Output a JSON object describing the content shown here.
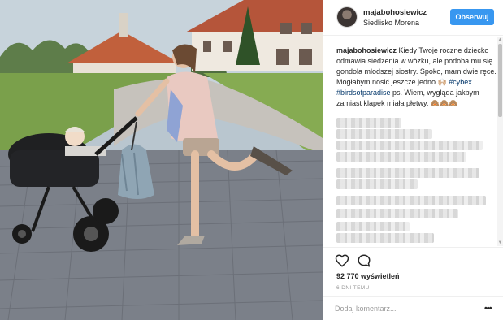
{
  "post": {
    "username": "majabohosiewicz",
    "location": "Siedlisko Morena",
    "follow_label": "Obserwuj",
    "caption": {
      "user": "majabohosiewicz",
      "text": "Kiedy Twoje roczne dziecko odmawia siedzenia w wózku, ale podoba mu się gondola młodszej siostry. Spoko, mam dwie ręce. Mogłabym nosić jeszcze jedno 🙌🏼 ",
      "tag1": "#cybex",
      "tag2": "#birdsofparadise",
      "text2": " ps. Wiem, wygląda jakbym zamiast klapek miała płetwy. 🙈🙈🙈"
    },
    "views": "92 770 wyświetleń",
    "timestamp": "6 DNI TEMU",
    "comment_placeholder": "Dodaj komentarz...",
    "more_label": "•••"
  },
  "icons": {
    "avatar": "profile-avatar",
    "like": "heart-icon",
    "comment": "comment-bubble-icon",
    "more": "more-options-icon"
  },
  "colors": {
    "accent": "#3897f0",
    "hashtag": "#003569",
    "text": "#262626",
    "muted": "#999999",
    "divider": "#efefef"
  }
}
